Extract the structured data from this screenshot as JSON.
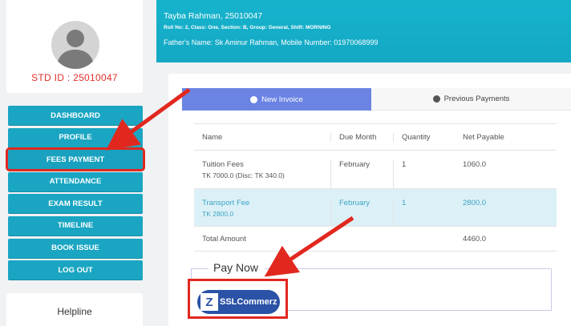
{
  "sidebar": {
    "std_id": "STD ID : 25010047",
    "menu": [
      "DASHBOARD",
      "PROFILE",
      "FEES PAYMENT",
      "ATTENDANCE",
      "EXAM RESULT",
      "TIMELINE",
      "BOOK ISSUE",
      "LOG OUT"
    ],
    "helpline": "Helpline"
  },
  "header": {
    "name": "Tayba Rahman, 25010047",
    "info": "Roll No: 2, Class: One, Section: B, Group: General, Shift: MORNING",
    "father": "Father's Name: Sk Aminur Rahman, Mobile Number: 01970068999"
  },
  "tabs": {
    "new_invoice": "New Invoice",
    "previous_payments": "Previous Payments"
  },
  "table": {
    "headers": [
      "Name",
      "Due Month",
      "Quantity",
      "Net Payable"
    ],
    "rows": [
      {
        "name": "Tuition Fees",
        "detail": "TK 7000.0 (Disc: TK 340.0)",
        "month": "February",
        "qty": "1",
        "net": "1060.0"
      },
      {
        "name": "Transport Fee",
        "detail": "TK 2800.0",
        "month": "February",
        "qty": "1",
        "net": "2800.0"
      }
    ],
    "total_label": "Total Amount",
    "total_value": "4460.0"
  },
  "pay": {
    "title": "Pay Now",
    "gateway": "SSLCommerz",
    "gateway_logo": "Z"
  },
  "colors": {
    "accent": "#1aa6c3",
    "tab_active": "#6b84e3",
    "highlight": "#e1281f"
  }
}
